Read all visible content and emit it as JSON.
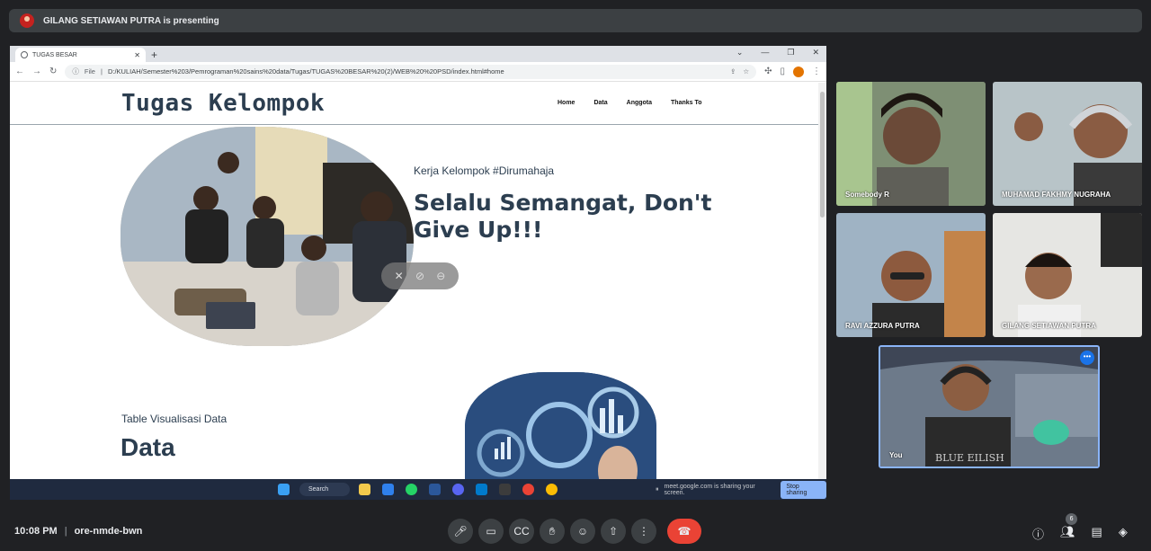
{
  "presenter_bar": {
    "text": "GILANG SETIAWAN PUTRA is presenting"
  },
  "browser": {
    "tab_title": "TUGAS BESAR",
    "file_label": "File",
    "url": "D:/KULIAH/Semester%203/Pemrograman%20sains%20data/Tugas/TUGAS%20BESAR%20(2)/WEB%20%20PSD/index.html#home"
  },
  "site": {
    "title": "Tugas Kelompok",
    "nav": [
      "Home",
      "Data",
      "Anggota",
      "Thanks To"
    ],
    "hero_kicker": "Kerja Kelompok #Dirumahaja",
    "hero_title": "Selalu Semangat, Don't Give Up!!!",
    "data_kicker": "Table Visualisasi Data",
    "data_title": "Data"
  },
  "taskbar": {
    "search_label": "Search",
    "share_notice": "meet.google.com is sharing your screen.",
    "stop_button": "Stop sharing"
  },
  "participants": [
    {
      "name": "Somebody R"
    },
    {
      "name": "MUHAMAD FAKHMY NUGRAHA"
    },
    {
      "name": "RAVI AZZURA PUTRA"
    },
    {
      "name": "GILANG SETIAWAN PUTRA"
    },
    {
      "name": "You"
    }
  ],
  "you_tile": {
    "shirt_text": "BLUE EILISH"
  },
  "meeting": {
    "time": "10:08 PM",
    "code": "ore-nmde-bwn",
    "people_count": "6"
  },
  "icons": {
    "mic": "mic-icon",
    "camera": "camera-icon",
    "captions": "captions-icon",
    "hand": "raise-hand-icon",
    "emoji": "emoji-icon",
    "present": "present-icon",
    "more": "more-icon",
    "end": "end-call-icon",
    "info": "info-icon",
    "people": "people-icon",
    "chat": "chat-icon",
    "activities": "activities-icon"
  },
  "colors": {
    "meet_bg": "#202124",
    "end_call": "#ea4335",
    "site_heading": "#2c3e50",
    "stop_share": "#8ab4f8"
  }
}
